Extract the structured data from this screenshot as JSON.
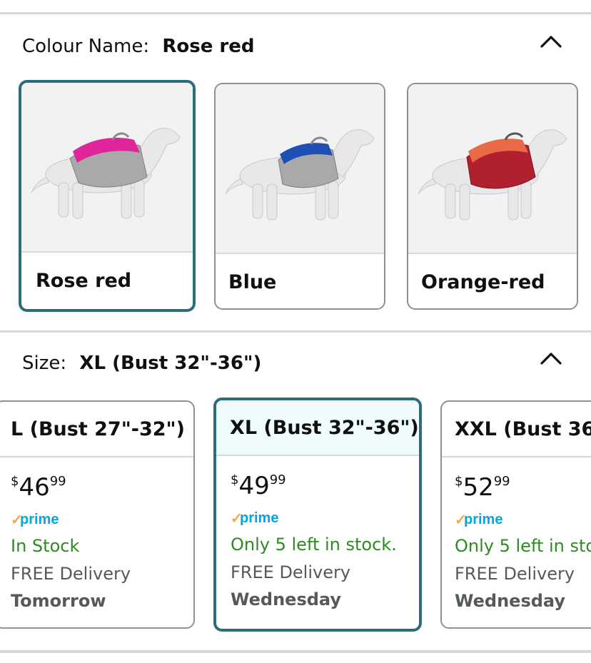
{
  "colour": {
    "label": "Colour Name:",
    "selected": "Rose red",
    "options": [
      {
        "label": "Rose red",
        "vest_color": "#e0259a",
        "trim_color": "#a9a9a9"
      },
      {
        "label": "Blue",
        "vest_color": "#1f4fb5",
        "trim_color": "#a9a9a9"
      },
      {
        "label": "Orange-red",
        "vest_color": "#e96a45",
        "trim_color": "#b0202e"
      }
    ]
  },
  "size": {
    "label": "Size:",
    "selected": "XL (Bust 32\"-36\")",
    "options": [
      {
        "title": "L (Bust 27\"-32\")",
        "currency": "$",
        "price_whole": "46",
        "price_fraction": "99",
        "stock": "In Stock",
        "delivery": "FREE Delivery",
        "day": "Tomorrow"
      },
      {
        "title": "XL (Bust 32\"-36\")",
        "currency": "$",
        "price_whole": "49",
        "price_fraction": "99",
        "stock": "Only 5 left in stock.",
        "delivery": "FREE Delivery",
        "day": "Wednesday"
      },
      {
        "title": "XXL (Bust 36\"",
        "currency": "$",
        "price_whole": "52",
        "price_fraction": "99",
        "stock": "Only 5 left in stoc",
        "delivery": "FREE Delivery",
        "day": "Wednesday"
      }
    ]
  },
  "prime_badge": {
    "check": "✓",
    "text": "prime"
  },
  "icons": {
    "collapse": "chevron-up-icon"
  },
  "colors": {
    "selected_border": "#2b6d7d",
    "in_stock": "#2f8a23",
    "prime_blue": "#00a8e1",
    "prime_orange": "#f3a847"
  }
}
